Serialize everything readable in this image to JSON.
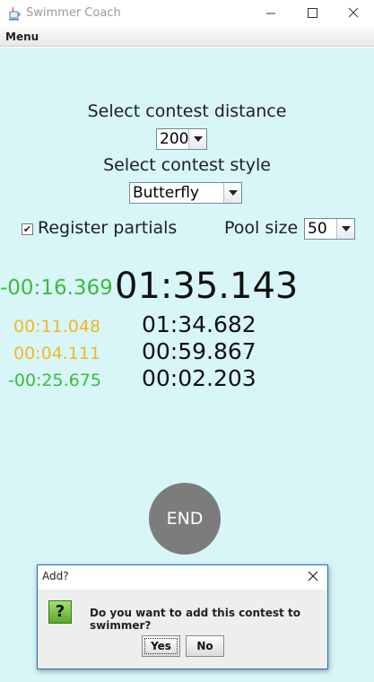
{
  "window": {
    "title": "Swimmer Coach",
    "icons": [
      "java-app-icon",
      "minimize-icon",
      "maximize-icon",
      "close-icon"
    ]
  },
  "menubar": {
    "menu_label": "Menu"
  },
  "form": {
    "distance_label": "Select contest distance",
    "distance_value": "200",
    "style_label": "Select contest style",
    "style_value": "Butterfly",
    "register_partials_label": "Register partials",
    "register_partials_checked": true,
    "pool_size_label": "Pool size",
    "pool_size_value": "50"
  },
  "timer": {
    "main_time": "01:35.143",
    "main_diff": "-00:16.369",
    "main_diff_color": "#3cbc3c"
  },
  "splits": [
    {
      "time": "01:34.682",
      "diff": "00:11.048",
      "diff_color": "#f3b72a"
    },
    {
      "time": "00:59.867",
      "diff": "00:04.111",
      "diff_color": "#f3b72a"
    },
    {
      "time": "00:02.203",
      "diff": "-00:25.675",
      "diff_color": "#3cbc3c"
    }
  ],
  "end_button": {
    "label": "END",
    "color": "#7c7c7c"
  },
  "dialog": {
    "title": "Add?",
    "icon": "question-icon",
    "message": "Do you want to add this contest to swimmer?",
    "yes_label": "Yes",
    "no_label": "No"
  },
  "colors": {
    "background": "#d8f6f7",
    "positive": "#f3b72a",
    "negative": "#3cbc3c"
  }
}
